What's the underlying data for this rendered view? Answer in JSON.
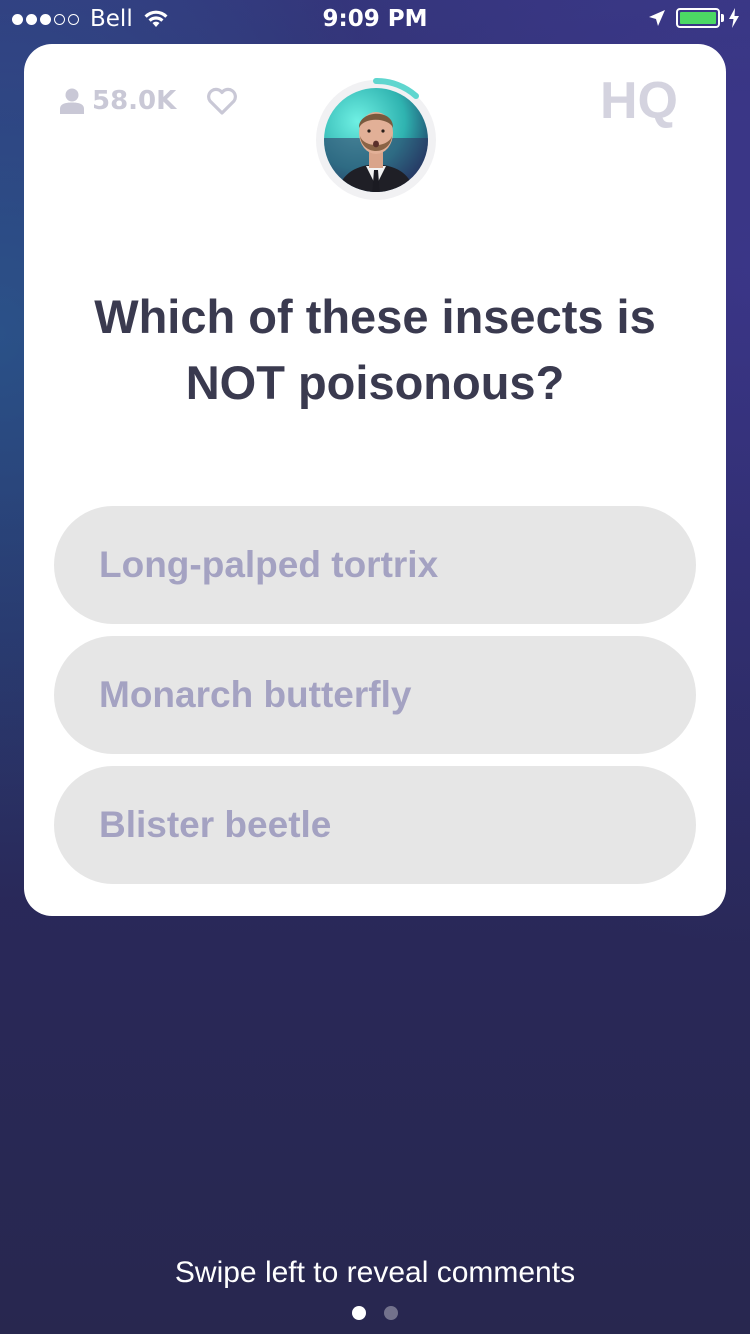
{
  "status_bar": {
    "carrier": "Bell",
    "time": "9:09 PM",
    "signal_strength": 3,
    "signal_max": 5,
    "battery_level": 1.0,
    "battery_color": "#4cd964",
    "icons": [
      "wifi-icon",
      "location-icon",
      "battery-icon",
      "charging-bolt-icon"
    ]
  },
  "card": {
    "viewer_count": "58.0K",
    "viewer_icon": "user-icon",
    "like_icon": "heart-icon",
    "logo_text": "HQ",
    "host_timer_progress": 0.15,
    "timer_color": "#5fd6cf",
    "question": "Which of these insects is NOT poisonous?",
    "answers": [
      {
        "label": "Long-palped tortrix"
      },
      {
        "label": "Monarch butterfly"
      },
      {
        "label": "Blister beetle"
      }
    ]
  },
  "footer": {
    "hint": "Swipe left to reveal comments",
    "page_count": 2,
    "active_page": 1
  },
  "colors": {
    "background": "#2a2a62",
    "card": "#ffffff",
    "question_text": "#3a3a4f",
    "answer_bg": "#e6e6e6",
    "answer_text": "#a4a2c2",
    "muted": "#c9c8d6"
  }
}
